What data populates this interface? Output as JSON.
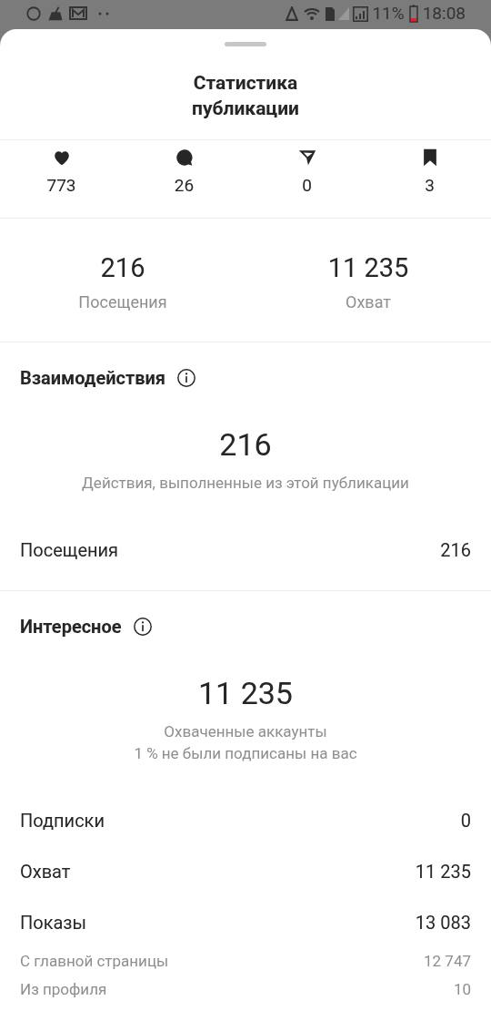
{
  "status_bar": {
    "battery": "11%",
    "time": "18:08"
  },
  "title": "Статистика\nпубликации",
  "engagement": [
    {
      "kind": "heart",
      "count": "773"
    },
    {
      "kind": "comment",
      "count": "26"
    },
    {
      "kind": "send",
      "count": "0"
    },
    {
      "kind": "bookmark",
      "count": "3"
    }
  ],
  "summary": [
    {
      "value": "216",
      "label": "Посещения"
    },
    {
      "value": "11 235",
      "label": "Охват"
    }
  ],
  "sections": [
    {
      "title": "Взаимодействия",
      "big_value": "216",
      "captions": [
        "Действия, выполненные из этой публикации"
      ],
      "rows": [
        {
          "kind": "main",
          "label": "Посещения",
          "value": "216"
        }
      ]
    },
    {
      "title": "Интересное",
      "big_value": "11 235",
      "captions": [
        "Охваченные аккаунты",
        "1 % не были подписаны на вас"
      ],
      "rows": [
        {
          "kind": "main",
          "label": "Подписки",
          "value": "0"
        },
        {
          "kind": "main",
          "label": "Охват",
          "value": "11 235"
        },
        {
          "kind": "main",
          "label": "Показы",
          "value": "13 083"
        },
        {
          "kind": "sub",
          "label": "С главной страницы",
          "value": "12 747"
        },
        {
          "kind": "sub",
          "label": "Из профиля",
          "value": "10"
        }
      ]
    }
  ]
}
